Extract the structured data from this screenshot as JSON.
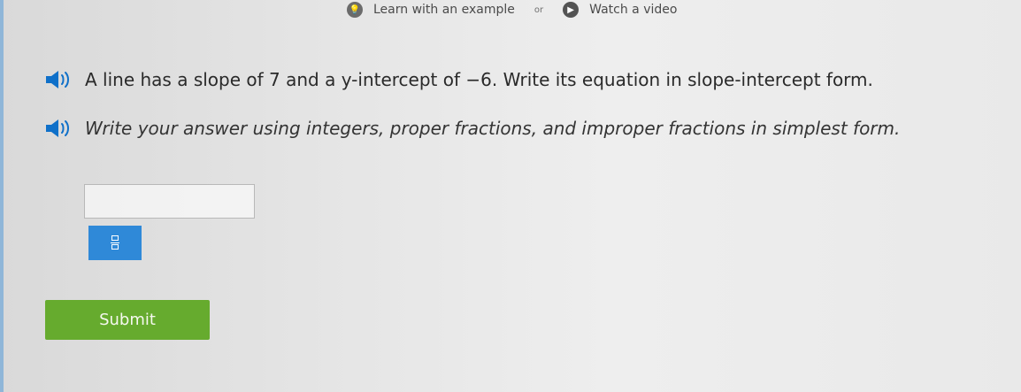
{
  "top_links": {
    "learn_label": "Learn with an example",
    "separator": "or",
    "watch_label": "Watch a video"
  },
  "question": {
    "text": "A line has a slope of 7 and a y-intercept of −6. Write its equation in slope-intercept form."
  },
  "instruction": {
    "text": "Write your answer using integers, proper fractions, and improper fractions in simplest form."
  },
  "answer": {
    "value": "",
    "placeholder": ""
  },
  "submit": {
    "label": "Submit"
  },
  "colors": {
    "accent_blue": "#2f89d8",
    "submit_green": "#66ab2e"
  },
  "icons": {
    "learn": "lightbulb-icon",
    "watch": "play-icon",
    "audio": "speaker-icon",
    "fraction": "fraction-icon"
  }
}
